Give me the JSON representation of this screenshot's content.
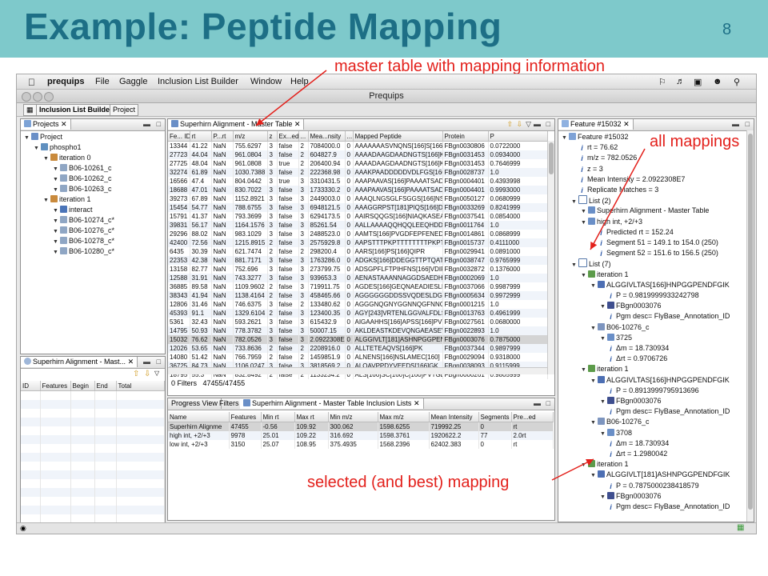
{
  "slide": {
    "title": "Example: Peptide Mapping",
    "number": "8",
    "callout_master": "master table with mapping information",
    "callout_all": "all mappings",
    "callout_selected": "selected (and best) mapping"
  },
  "colors": {
    "accent_red": "#e3201b",
    "header_teal": "#7ec9cb",
    "title_blue": "#1d6f86"
  },
  "app": {
    "menubar": {
      "items": [
        "prequips",
        "File",
        "Gaggle",
        "Inclusion List Builder",
        "Window",
        "Help"
      ]
    },
    "window_title": "Prequips",
    "perspective_tabs": [
      "Inclusion List Builder",
      "Project"
    ],
    "projects": {
      "tab": "Projects",
      "tree": [
        {
          "label": "Project",
          "icon": "folder-icon",
          "depth": 0
        },
        {
          "label": "phospho1",
          "icon": "person-icon",
          "depth": 1
        },
        {
          "label": "iteration 0",
          "icon": "grid-icon",
          "depth": 2
        },
        {
          "label": "B06-10261_c",
          "icon": "file-icon",
          "depth": 3
        },
        {
          "label": "B06-10262_c",
          "icon": "file-icon",
          "depth": 3
        },
        {
          "label": "B06-10263_c",
          "icon": "file-icon",
          "depth": 3
        },
        {
          "label": "iteration 1",
          "icon": "grid-icon",
          "depth": 2
        },
        {
          "label": "interact",
          "icon": "link-icon",
          "depth": 3
        },
        {
          "label": "B06-10274_c*",
          "icon": "file-icon",
          "depth": 3
        },
        {
          "label": "B06-10276_c*",
          "icon": "file-icon",
          "depth": 3
        },
        {
          "label": "B06-10278_c*",
          "icon": "file-icon",
          "depth": 3
        },
        {
          "label": "B06-10280_c*",
          "icon": "file-icon",
          "depth": 3
        }
      ]
    },
    "small_list": {
      "tab": "Superhirn Alignment - Mast...",
      "columns": [
        "ID",
        "Features",
        "Begin",
        "End",
        "Total"
      ]
    },
    "master_table": {
      "tab": "Superhirn Alignment - Master Table",
      "columns": [
        "Fe... ID",
        "rt",
        "P...rt",
        "m/z",
        "z",
        "Ex...ed",
        "...",
        "Mea...nsity",
        "...",
        "Mapped Peptide",
        "Protein",
        "P"
      ],
      "rows": [
        [
          "13344",
          "41.22",
          "NaN",
          "755.6297",
          "3",
          "false",
          "2",
          "7084000.0",
          "0",
          "AAAAAAASVNQNS[166]S[166]LA",
          "FBgn0030806",
          "0.0722000"
        ],
        [
          "27723",
          "44.04",
          "NaN",
          "961.0804",
          "3",
          "false",
          "2",
          "604827.9",
          "0",
          "AAAADAAGDAADNGTS[166]KDG",
          "FBgn0031453",
          "0.0934000"
        ],
        [
          "27725",
          "48.04",
          "NaN",
          "961.0808",
          "3",
          "true",
          "2",
          "206400.94",
          "0",
          "AAAADAAGDAADNGTS[166]KDG",
          "FBgn0031453",
          "0.7646999"
        ],
        [
          "32274",
          "61.89",
          "NaN",
          "1030.7388",
          "3",
          "false",
          "2",
          "222368.98",
          "0",
          "AAAKPAADDDDDVDLFGS[166]DE",
          "FBgn0028737",
          "1.0"
        ],
        [
          "16566",
          "47.4",
          "NaN",
          "804.0442",
          "3",
          "true",
          "3",
          "3310431.5",
          "0",
          "AAAPAAVAS[166]PAAAATSADASP",
          "FBgn0004401",
          "0.4393998"
        ],
        [
          "18688",
          "47.01",
          "NaN",
          "830.7022",
          "3",
          "false",
          "3",
          "1733330.2",
          "0",
          "AAAPAAVAS[166]PAAAATSADAS[",
          "FBgn0004401",
          "0.9993000"
        ],
        [
          "39273",
          "67.89",
          "NaN",
          "1152.8921",
          "3",
          "false",
          "3",
          "2449003.0",
          "0",
          "AAAQLNGSGLFSGGS[166]NSSGS",
          "FBgn0050127",
          "0.0680999"
        ],
        [
          "15454",
          "54.77",
          "NaN",
          "788.6755",
          "3",
          "false",
          "3",
          "6948121.5",
          "0",
          "AAAGGRPST[181]PIQS[166]DSELT",
          "FBgn0033269",
          "0.8241999"
        ],
        [
          "15791",
          "41.37",
          "NaN",
          "793.3699",
          "3",
          "false",
          "3",
          "6294173.5",
          "0",
          "AAIRSQQGS[166]NIAQKASEAQR",
          "FBgn0037541",
          "0.0854000"
        ],
        [
          "39831",
          "56.17",
          "NaN",
          "1164.1576",
          "3",
          "false",
          "3",
          "85261.54",
          "0",
          "AALLAAAAQQHQQLEEQHDDDDRV",
          "FBgn0011764",
          "1.0"
        ],
        [
          "29296",
          "88.02",
          "NaN",
          "983.1029",
          "3",
          "false",
          "3",
          "2488523.0",
          "0",
          "AAMTS[166]PVGDFEPFENEDEIGE",
          "FBgn0014861",
          "0.0868999"
        ],
        [
          "42400",
          "72.56",
          "NaN",
          "1215.8915",
          "2",
          "false",
          "3",
          "2575929.8",
          "0",
          "AAPSTTTPKPTTTTTTTTPKPTTK",
          "FBgn0015737",
          "0.4111000"
        ],
        [
          "6435",
          "30.39",
          "NaN",
          "621.7474",
          "2",
          "false",
          "2",
          "298200.4",
          "0",
          "AARS[166]PS[166]QIPR",
          "FBgn0029941",
          "0.0891000"
        ],
        [
          "22353",
          "42.38",
          "NaN",
          "881.7171",
          "3",
          "false",
          "3",
          "1763286.0",
          "0",
          "ADGKS[166]DDEGGTTPTQATIDNG",
          "FBgn0038747",
          "0.9765999"
        ],
        [
          "13158",
          "82.77",
          "NaN",
          "752.696",
          "3",
          "false",
          "3",
          "273799.75",
          "0",
          "ADSGPFLFTPIHFNS[166]VDIR",
          "FBgn0032872",
          "0.1376000"
        ],
        [
          "12588",
          "31.91",
          "NaN",
          "743.3277",
          "3",
          "false",
          "3",
          "939653.3",
          "0",
          "AENASTAAANNAGGDSAEDHAAGF",
          "FBgn0002069",
          "1.0"
        ],
        [
          "36885",
          "89.58",
          "NaN",
          "1109.9602",
          "2",
          "false",
          "3",
          "719911.75",
          "0",
          "AGDES[166]GEQNAEADIESLFEK",
          "FBgn0037066",
          "0.9987999"
        ],
        [
          "38343",
          "41.94",
          "NaN",
          "1138.4164",
          "2",
          "false",
          "3",
          "458465.66",
          "0",
          "AGGGGGGDDSSVQDESLDGEDS[1",
          "FBgn0005634",
          "0.9972999"
        ],
        [
          "12806",
          "31.46",
          "NaN",
          "746.6375",
          "3",
          "false",
          "2",
          "133480.62",
          "0",
          "AGGGNQGNYGGNNQGFNNGGNN",
          "FBgn0001215",
          "1.0"
        ],
        [
          "45393",
          "91.1",
          "NaN",
          "1329.6104",
          "2",
          "false",
          "3",
          "123400.35",
          "0",
          "AGY[243]VRTENLGGVALFDLSYDK",
          "FBgn0013763",
          "0.4961999"
        ],
        [
          "5361",
          "32.43",
          "NaN",
          "593.2621",
          "3",
          "false",
          "3",
          "615432.9",
          "0",
          "AIGAAHHS[166]APSS[166]PVTSK",
          "FBgn0027561",
          "0.0680000"
        ],
        [
          "14795",
          "50.93",
          "NaN",
          "778.3782",
          "3",
          "false",
          "3",
          "50007.15",
          "0",
          "AKLDEASTKDEVQNGAEASEVAA",
          "FBgn0022893",
          "1.0"
        ],
        [
          "15032",
          "76.62",
          "NaN",
          "782.0526",
          "3",
          "false",
          "3",
          "2.0922308E7",
          "0",
          "ALGGIVLT[181]ASHNPGGPENDFG",
          "FBgn0003076",
          "0.7875000"
        ],
        [
          "12026",
          "53.65",
          "NaN",
          "733.8636",
          "2",
          "false",
          "2",
          "2208916.0",
          "0",
          "ALLTETEAQVS[166]PK",
          "FBgn0037344",
          "0.9897999"
        ],
        [
          "14080",
          "51.42",
          "NaN",
          "766.7959",
          "2",
          "false",
          "2",
          "1459851.9",
          "0",
          "ALNENS[166]NSLAMEC[160]",
          "FBgn0029094",
          "0.9318000"
        ],
        [
          "36725",
          "84.73",
          "NaN",
          "1106.0247",
          "3",
          "false",
          "3",
          "3818569.2",
          "0",
          "ALQAVPPDYVEEDS[166]GK",
          "FBgn0038093",
          "0.9115999"
        ],
        [
          "18795",
          "55.3",
          "NaN",
          "832.8492",
          "2",
          "false",
          "2",
          "1133234.2",
          "0",
          "ALS[166]SC[160]C[160]PVTGDVY",
          "FBgn0000261",
          "0.9805999"
        ]
      ],
      "selected_row": 22,
      "footer": {
        "filters": "0 Filters",
        "count": "47455/47455"
      }
    },
    "inclusion_lists": {
      "tabs": [
        "Progress View",
        "Filters",
        "Superhirn Alignment - Master Table Inclusion Lists"
      ],
      "columns": [
        "Name",
        "Features",
        "Min rt",
        "Max rt",
        "Min m/z",
        "Max m/z",
        "Mean Intensity",
        "Segments",
        "Pre...ed"
      ],
      "rows": [
        [
          "Superhirn Alignme",
          "47455",
          "-0.56",
          "109.92",
          "300.062",
          "1598.6255",
          "719992.25",
          "0",
          "rt"
        ],
        [
          "high int, +2/+3",
          "9978",
          "25.01",
          "109.22",
          "316.692",
          "1598.3761",
          "1920622.2",
          "77",
          "2.0rt"
        ],
        [
          "low int, +2/+3",
          "3150",
          "25.07",
          "108.95",
          "375.4935",
          "1568.2396",
          "62402.383",
          "0",
          "rt"
        ]
      ],
      "selected_row": 0
    },
    "feature": {
      "tab": "Feature #15032",
      "tree": [
        {
          "label": "Feature #15032",
          "icon": "feature-icon",
          "depth": 0
        },
        {
          "label": "rt = 76.62",
          "icon": "info-icon",
          "depth": 1
        },
        {
          "label": "m/z = 782.0526",
          "icon": "info-icon",
          "depth": 1
        },
        {
          "label": "z = 3",
          "icon": "info-icon",
          "depth": 1
        },
        {
          "label": "Mean Intensity = 2.0922308E7",
          "icon": "info-icon",
          "depth": 1
        },
        {
          "label": "Replicate Matches = 3",
          "icon": "info-icon",
          "depth": 1
        },
        {
          "label": "List (2)",
          "icon": "list-icon",
          "depth": 1
        },
        {
          "label": "Superhirn Alignment - Master Table",
          "icon": "table-icon",
          "depth": 2
        },
        {
          "label": "high int, +2/+3",
          "icon": "table-icon",
          "depth": 2
        },
        {
          "label": "Predicted rt = 152.24",
          "icon": "info-icon",
          "depth": 3
        },
        {
          "label": "Segment 51 = 149.1 to 154.0 (250)",
          "icon": "info-icon",
          "depth": 3
        },
        {
          "label": "Segment 52 = 151.6 to 156.5 (250)",
          "icon": "info-icon",
          "depth": 3
        },
        {
          "label": "List (7)",
          "icon": "list-icon",
          "depth": 1
        },
        {
          "label": "iteration 1",
          "icon": "iteration-icon",
          "depth": 2
        },
        {
          "label": "ALGGIVLTAS[166]HNPGGPENDFGIK",
          "icon": "peptide-icon",
          "depth": 3
        },
        {
          "label": "P = 0.9819999933242798",
          "icon": "info-icon",
          "depth": 4
        },
        {
          "label": "FBgn0003076",
          "icon": "protein-icon",
          "depth": 4
        },
        {
          "label": "Pgm desc= FlyBase_Annotation_ID",
          "icon": "info-icon",
          "depth": 4
        },
        {
          "label": "B06-10276_c",
          "icon": "sample-icon",
          "depth": 3
        },
        {
          "label": "3725",
          "icon": "table-icon",
          "depth": 4
        },
        {
          "label": "Δm = 18.730934",
          "icon": "info-icon",
          "depth": 4
        },
        {
          "label": "Δrt = 0.9706726",
          "icon": "info-icon",
          "depth": 4
        },
        {
          "label": "iteration 1",
          "icon": "iteration-icon",
          "depth": 2
        },
        {
          "label": "ALGGIVLTAS[166]HNPGGPENDFGIK",
          "icon": "peptide-icon",
          "depth": 3
        },
        {
          "label": "P = 0.8913999795913696",
          "icon": "info-icon",
          "depth": 4
        },
        {
          "label": "FBgn0003076",
          "icon": "protein-icon",
          "depth": 4
        },
        {
          "label": "Pgm desc= FlyBase_Annotation_ID",
          "icon": "info-icon",
          "depth": 4
        },
        {
          "label": "B06-10276_c",
          "icon": "sample-icon",
          "depth": 3
        },
        {
          "label": "3708",
          "icon": "table-icon",
          "depth": 4
        },
        {
          "label": "Δm = 18.730934",
          "icon": "info-icon",
          "depth": 4
        },
        {
          "label": "Δrt = 1.2980042",
          "icon": "info-icon",
          "depth": 4
        },
        {
          "label": "iteration 1",
          "icon": "iteration-icon",
          "depth": 2
        },
        {
          "label": "ALGGIVLT[181]ASHNPGGPENDFGIK",
          "icon": "peptide-icon",
          "depth": 3
        },
        {
          "label": "P = 0.7875000238418579",
          "icon": "info-icon",
          "depth": 4
        },
        {
          "label": "FBgn0003076",
          "icon": "protein-icon",
          "depth": 4
        },
        {
          "label": "Pgm desc= FlyBase_Annotation_ID",
          "icon": "info-icon",
          "depth": 4
        }
      ]
    }
  }
}
